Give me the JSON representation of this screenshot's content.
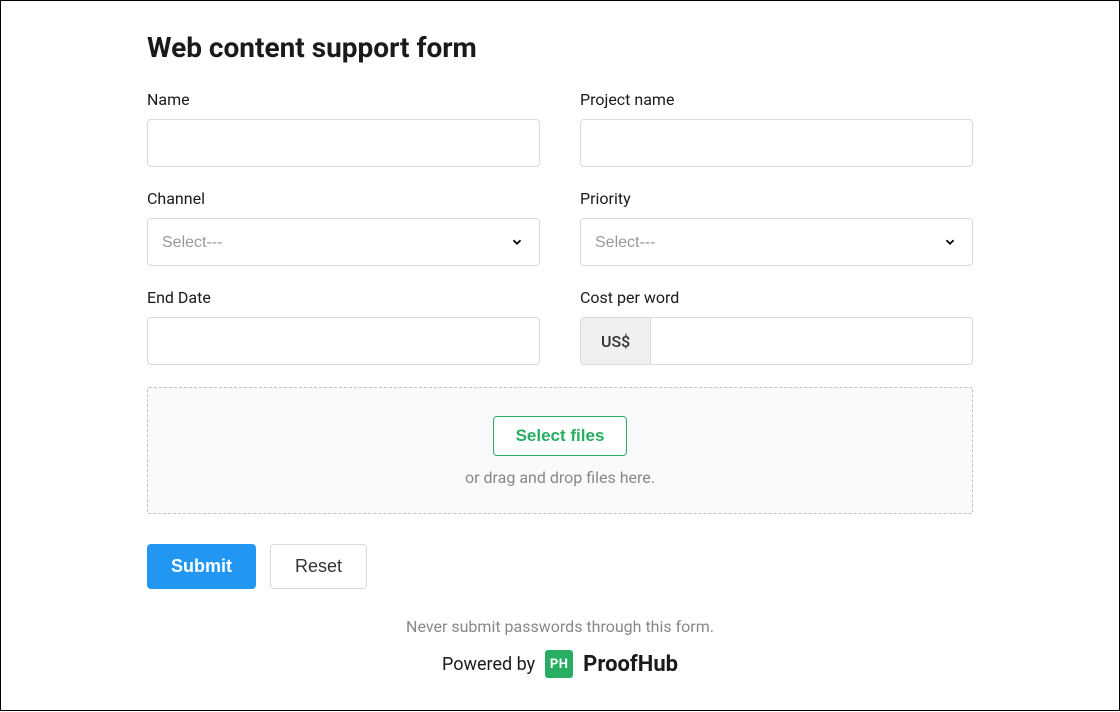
{
  "form": {
    "title": "Web content support form",
    "fields": {
      "name": {
        "label": "Name"
      },
      "project_name": {
        "label": "Project name"
      },
      "channel": {
        "label": "Channel",
        "placeholder": "Select---"
      },
      "priority": {
        "label": "Priority",
        "placeholder": "Select---"
      },
      "end_date": {
        "label": "End Date"
      },
      "cost_per_word": {
        "label": "Cost per word",
        "currency_prefix": "US$"
      }
    },
    "dropzone": {
      "button_label": "Select files",
      "hint": "or drag and drop files here."
    },
    "buttons": {
      "submit": "Submit",
      "reset": "Reset"
    }
  },
  "footer": {
    "warning": "Never submit passwords through this form.",
    "powered_by_text": "Powered by",
    "logo_initials": "PH",
    "brand_name": "ProofHub"
  }
}
